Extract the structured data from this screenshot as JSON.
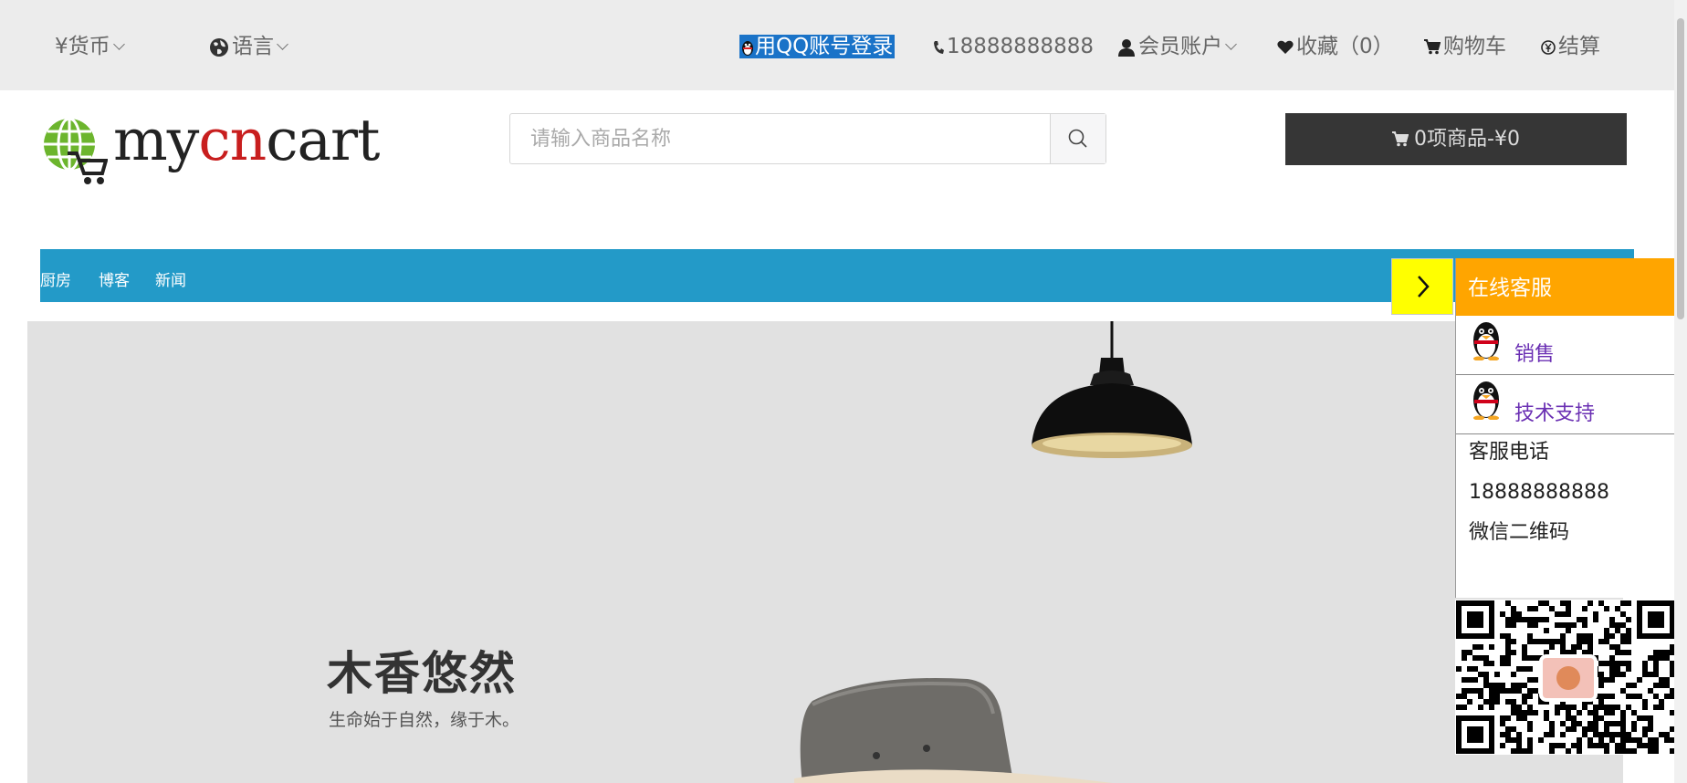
{
  "topbar": {
    "currency": "¥货币",
    "language": "语言",
    "qq_login": "用QQ账号登录",
    "phone": "18888888888",
    "account": "会员账户",
    "favorites": "收藏（0）",
    "cart": "购物车",
    "checkout": "结算"
  },
  "header": {
    "logo_left": "my",
    "logo_mid": "cn",
    "logo_right": "cart",
    "search_placeholder": "请输入商品名称",
    "cart_summary": "0项商品-¥0"
  },
  "nav": {
    "items": [
      "厨房",
      "博客",
      "新闻"
    ]
  },
  "banner": {
    "title": "木香悠然",
    "subtitle": "生命始于自然，缘于木。"
  },
  "service": {
    "title": "在线客服",
    "contacts": [
      "销售",
      "技术支持"
    ],
    "phone_label": "客服电话",
    "phone": "18888888888",
    "wechat_label": "微信二维码"
  },
  "colors": {
    "nav_bg": "#239ac8",
    "panel_head": "#ffa500",
    "toggle_bg": "#ffff00",
    "cart_bg": "#363636",
    "logo_accent": "#c81e1e"
  }
}
